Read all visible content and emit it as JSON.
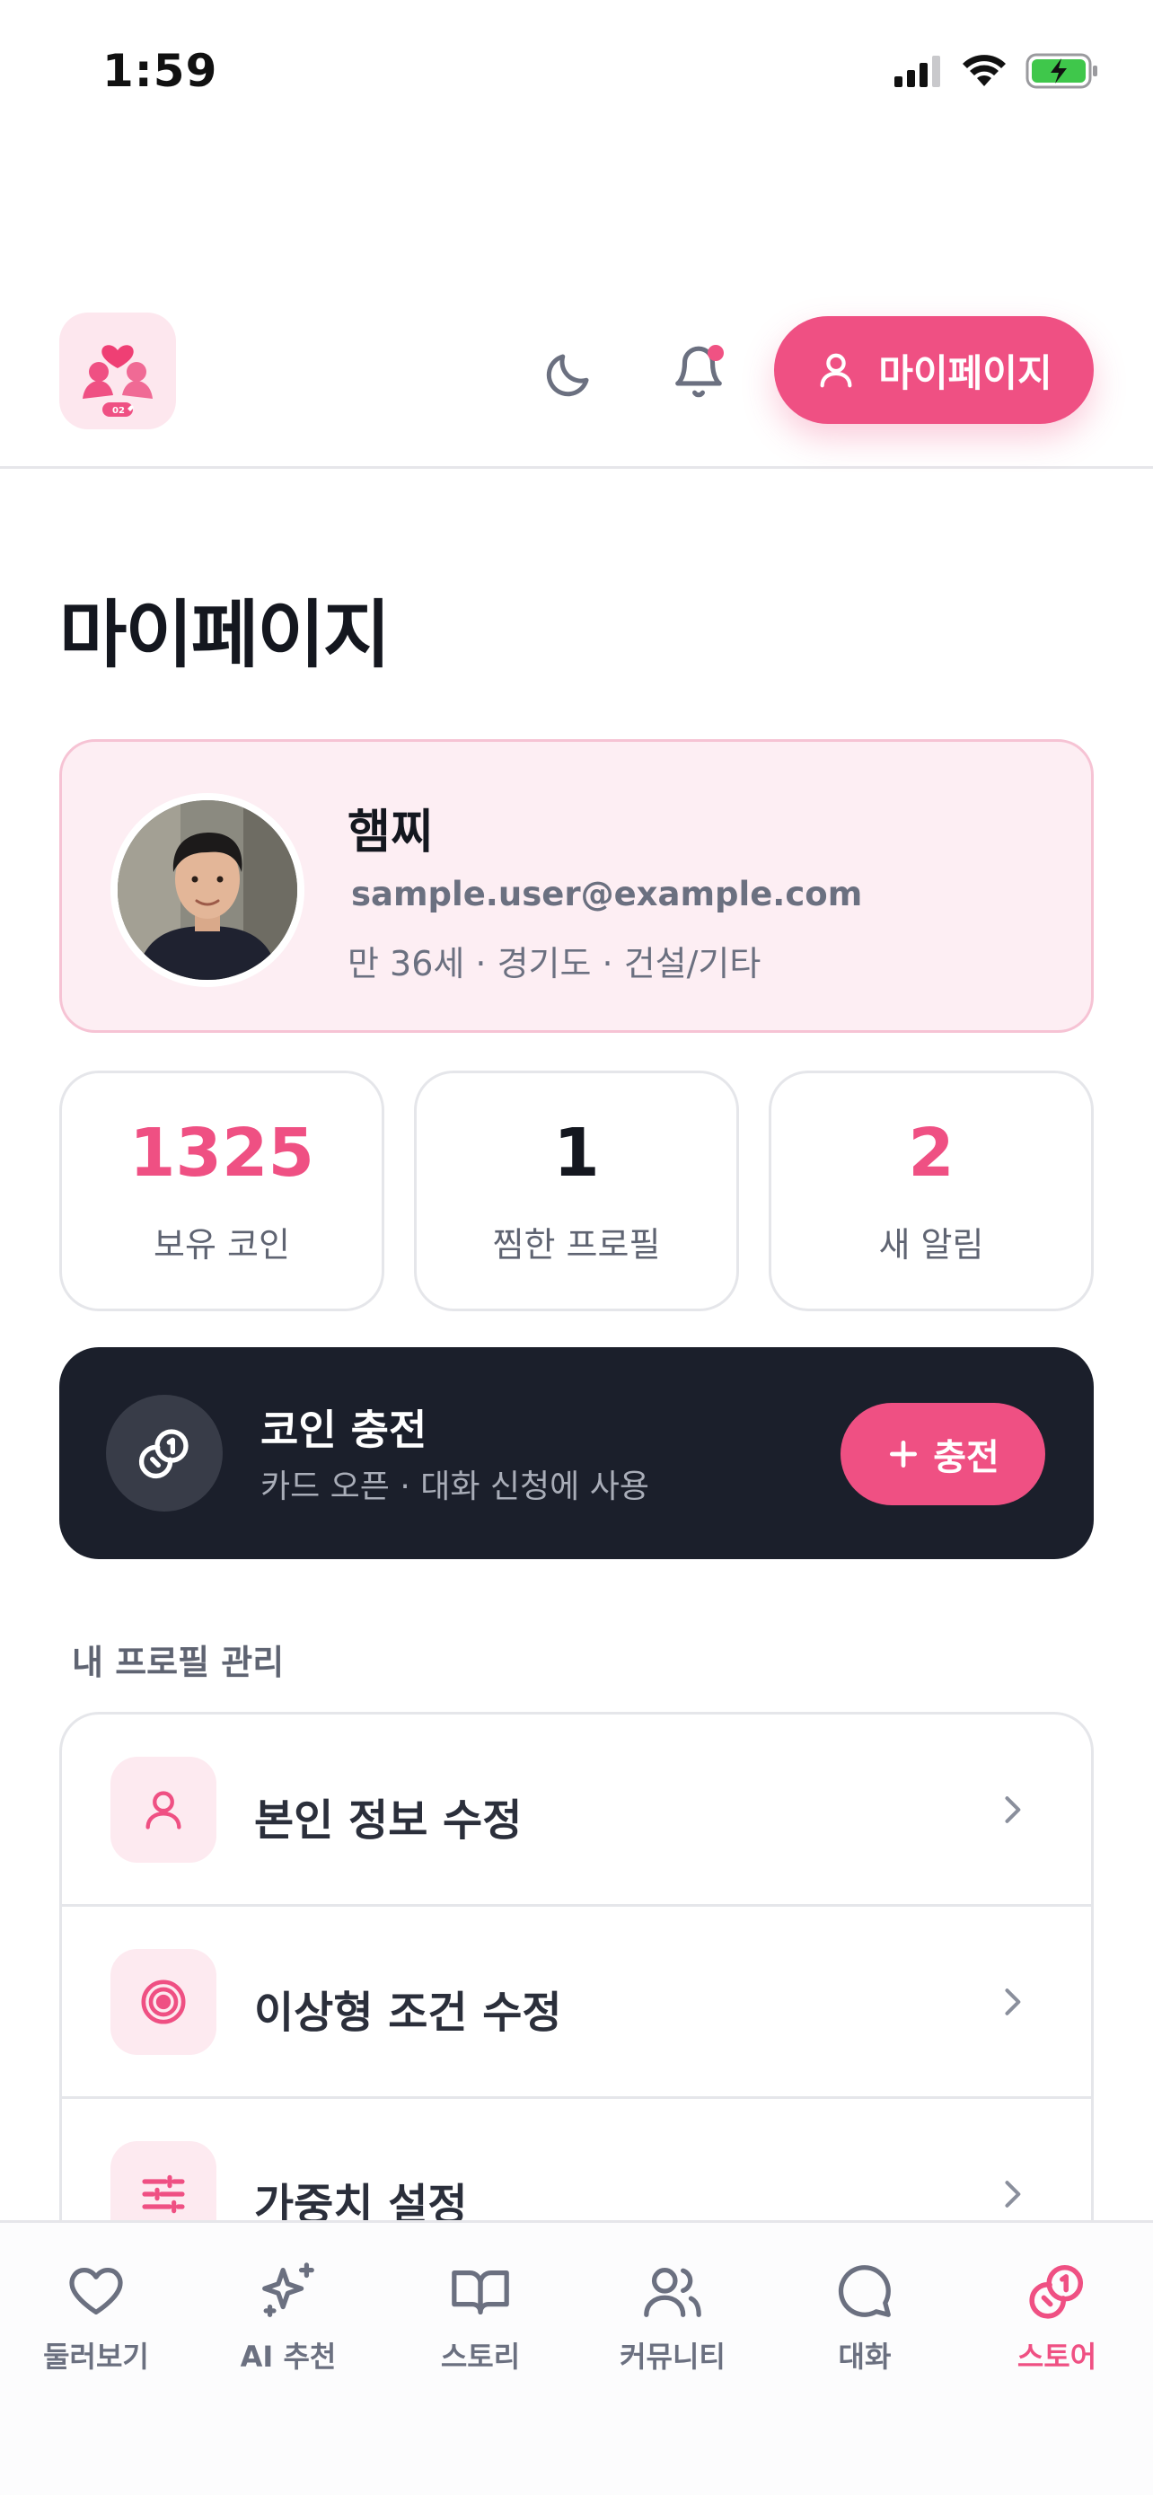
{
  "status_bar": {
    "time": "1:59"
  },
  "header": {
    "logo_badge": "02",
    "mypage_label": "마이페이지"
  },
  "page": {
    "title": "마이페이지"
  },
  "profile": {
    "name": "햄찌",
    "email": "sample.user@example.com",
    "meta": "만 36세 · 경기도 · 건설/기타"
  },
  "stats": [
    {
      "value": "1325",
      "label": "보유 코인",
      "color": "#ef5083"
    },
    {
      "value": "1",
      "label": "찜한 프로필",
      "color": "#14171f"
    },
    {
      "value": "2",
      "label": "새 알림",
      "color": "#ef5083"
    }
  ],
  "coin": {
    "title": "코인 충전",
    "desc": "카드 오픈 · 대화 신청에 사용",
    "button": "충전"
  },
  "section": {
    "title": "내 프로필 관리"
  },
  "menu": [
    {
      "label": "본인 정보 수정",
      "icon": "user-icon"
    },
    {
      "label": "이상형 조건 수정",
      "icon": "target-icon"
    },
    {
      "label": "가중치 설정",
      "icon": "sliders-icon"
    }
  ],
  "nav": [
    {
      "label": "둘러보기",
      "icon": "heart-icon"
    },
    {
      "label": "AI 추천",
      "icon": "sparkles-icon"
    },
    {
      "label": "스토리",
      "icon": "book-icon"
    },
    {
      "label": "커뮤니티",
      "icon": "users-icon"
    },
    {
      "label": "대화",
      "icon": "chat-icon"
    },
    {
      "label": "스토어",
      "icon": "coins-icon",
      "active": true
    }
  ],
  "colors": {
    "accent": "#ef5083",
    "dark": "#1b1f2b",
    "pink_bg": "#fdeef3"
  }
}
